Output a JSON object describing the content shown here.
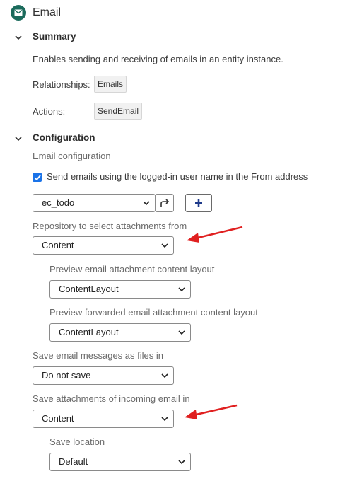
{
  "header": {
    "title": "Email",
    "icon": "mail-icon",
    "accent": "#1b6b5c"
  },
  "summary": {
    "heading": "Summary",
    "description": "Enables sending and receiving of emails in an entity instance.",
    "relationships_label": "Relationships:",
    "relationships_value": "Emails",
    "actions_label": "Actions:",
    "actions_value": "SendEmail"
  },
  "configuration": {
    "heading": "Configuration",
    "subheading": "Email configuration",
    "checkbox_label": "Send emails using the logged-in user name in the From address",
    "checkbox_checked": true,
    "ruleset_select": "ec_todo",
    "attachments_repo_label": "Repository to select attachments from",
    "attachments_repo_value": "Content",
    "preview_layout_label": "Preview email attachment content layout",
    "preview_layout_value": "ContentLayout",
    "preview_forward_label": "Preview forwarded email attachment content layout",
    "preview_forward_value": "ContentLayout",
    "save_messages_label": "Save email messages as files in",
    "save_messages_value": "Do not save",
    "save_attachments_label": "Save attachments of incoming email in",
    "save_attachments_value": "Content",
    "save_location_label": "Save location",
    "save_location_value": "Default"
  },
  "colors": {
    "arrow": "#e02020",
    "checkbox": "#1a73e8",
    "plus": "#1e3a8a"
  }
}
